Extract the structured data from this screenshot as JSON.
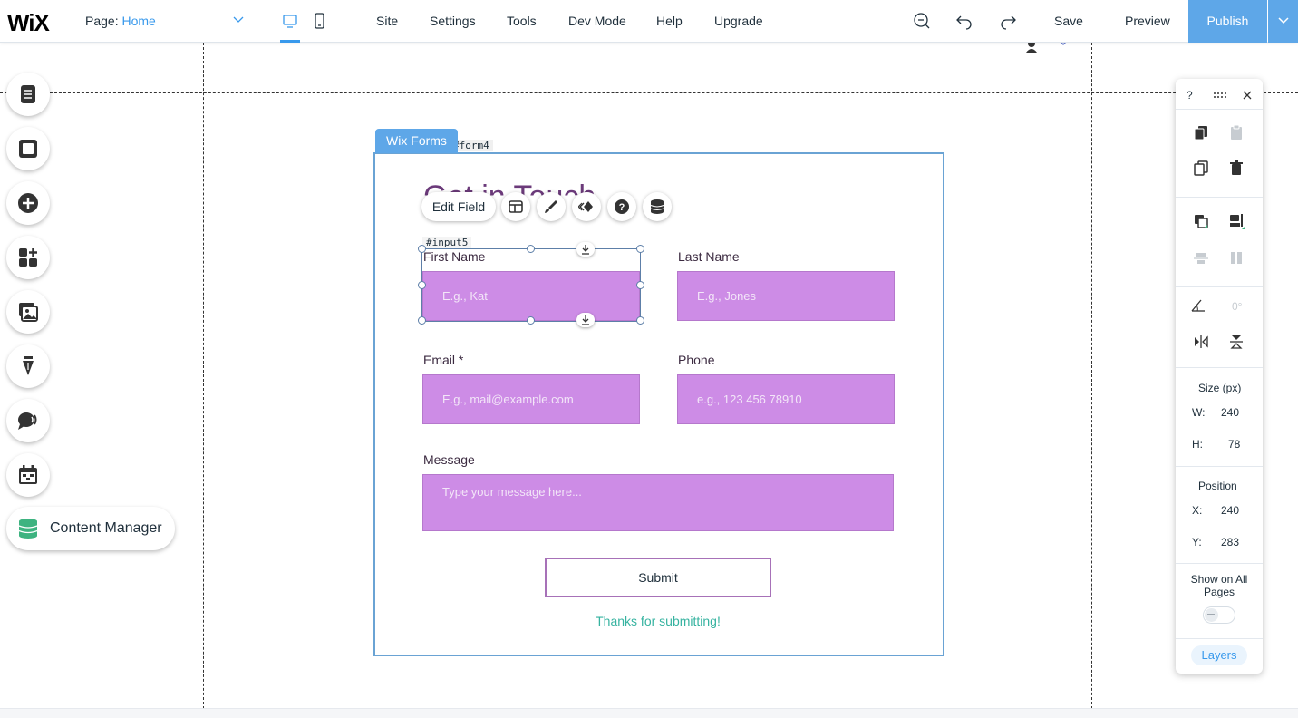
{
  "topbar": {
    "logo": "WiX",
    "page_label": "Page:",
    "page_value": "Home",
    "menu": [
      "Site",
      "Settings",
      "Tools",
      "Dev Mode",
      "Help",
      "Upgrade"
    ],
    "save": "Save",
    "preview": "Preview",
    "publish": "Publish",
    "active_device": "desktop"
  },
  "left_panel": {
    "buttons": [
      "pages-icon",
      "background-icon",
      "add-icon",
      "apps-icon",
      "media-icon",
      "blog-icon",
      "chat-icon",
      "bookings-icon"
    ],
    "content_manager": "Content Manager"
  },
  "form": {
    "tag": "Wix Forms",
    "id": "#form4",
    "title": "Get in Touch",
    "selected_input_id": "#input5",
    "toolbar": {
      "edit_field": "Edit Field"
    },
    "fields": {
      "first_name": {
        "label": "First Name",
        "placeholder": "E.g., Kat"
      },
      "last_name": {
        "label": "Last Name",
        "placeholder": "E.g., Jones"
      },
      "email": {
        "label": "Email *",
        "placeholder": "E.g., mail@example.com"
      },
      "phone": {
        "label": "Phone",
        "placeholder": "e.g., 123 456 78910"
      },
      "message": {
        "label": "Message",
        "placeholder": "Type your message here..."
      }
    },
    "submit": "Submit",
    "thanks": "Thanks for submitting!"
  },
  "inspector": {
    "help": "?",
    "rotation": "0°",
    "size_title": "Size (px)",
    "w_label": "W:",
    "w_value": "240",
    "h_label": "H:",
    "h_value": "78",
    "position_title": "Position",
    "x_label": "X:",
    "x_value": "240",
    "y_label": "Y:",
    "y_value": "283",
    "show_on_all_pages": "Show on All Pages",
    "show_on_all_pages_enabled": false,
    "layers": "Layers"
  },
  "colors": {
    "accent": "#3899ec",
    "publish": "#5ea7e8",
    "input_fill": "#cd8ce6",
    "submit_border": "#a771b8",
    "thanks": "#36b3a0"
  }
}
